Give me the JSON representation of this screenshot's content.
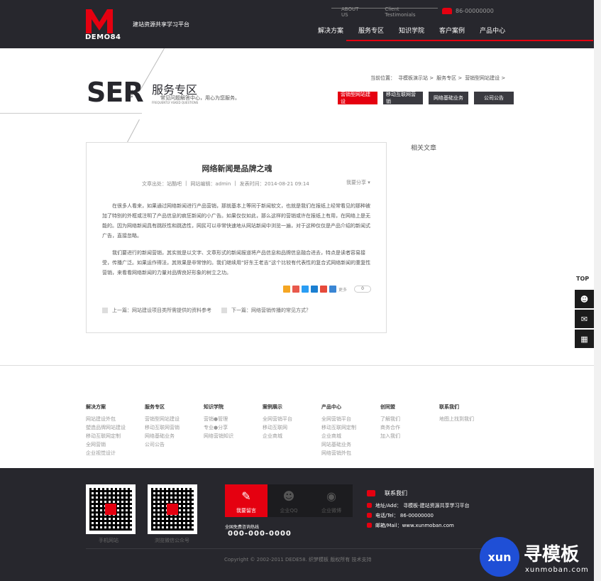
{
  "header": {
    "logo_text": "DEMO84",
    "tagline": "建站资源共享学习平台",
    "top_links": [
      "ABOUT US",
      "Client Testimonials"
    ],
    "phone": "86-00000000",
    "nav": [
      "解决方案",
      "服务专区",
      "知识学院",
      "客户案例",
      "产品中心"
    ]
  },
  "hero": {
    "logo": "SER",
    "logo_vert": "VICE",
    "title": "服务专区",
    "desc": "常见问题解答中心，用心为您服务。",
    "sub": "FREQUENTLY ASKED QUESTIONS",
    "breadcrumb": [
      "当前位置：",
      "寻模板演示站 >",
      "服务专区 >",
      "营销型网站建设 >"
    ],
    "tabs": [
      {
        "label": "营销型网站建设",
        "active": true
      },
      {
        "label": "移动互联网营销",
        "active": false
      },
      {
        "label": "网络基础业务",
        "active": false
      },
      {
        "label": "公司公告",
        "active": false
      }
    ]
  },
  "article": {
    "title": "网络新闻是品牌之魂",
    "meta": [
      "文章出处：站酷吧",
      "|",
      "网站编辑：admin",
      "|",
      "发表时间：2014-08-21 09:14"
    ],
    "share_label": "我要分享 ▾",
    "p1": "在很多人看来，如果通过网络新闻进行产品营销，那就基本上等同于新闻软文，也就是我们在报纸上经常看见的那种被加了特别的外框或注明了产品信息的疯狂新闻的小广告。如果仅仅如此，那么这样的营销或许在报纸上有用，在网络上是无能的。因为网络新闻具有跳跃性和跳选性，网民可以非常快速地从网站新闻中浏览一遍，对于这种仅仅是产品介绍的新闻式广告，直接忽略。",
    "p2": "我们要进行的新闻营销，其实就是以文字、文章形式的新闻报道将产品信息和品牌信息融合进去，特点是读者容易接受，传播广泛。如果运作得法，其效果是非常惊的。我们继续用“好东王老吉”这个比较有代表性的复合式网络新闻的重复性营销，来看看网络新闻的力量对品牌良好形象的树立之功。",
    "share_more": "更多",
    "share_count": "0",
    "prev": "上一篇：网站建设项目类所需提供的资料参考",
    "next": "下一篇：网络营销传播的常见方式？"
  },
  "sidebar": {
    "related": "相关文章",
    "top": "TOP"
  },
  "footer_links": [
    {
      "head": "解决方案",
      "items": [
        "网站建设外包",
        "塑造品牌网站建设",
        "移动互联网定制",
        "全网营销",
        "企业视觉设计"
      ]
    },
    {
      "head": "服务专区",
      "items": [
        "营销型网站建设",
        "移动互联网营销",
        "网络基础业务",
        "公司公告"
      ]
    },
    {
      "head": "知识学院",
      "items": [
        "营销●管理",
        "专业●分享",
        "网络营销知识"
      ]
    },
    {
      "head": "案例展示",
      "items": [
        "全网营销平台",
        "移动互联网",
        "企业商城"
      ]
    },
    {
      "head": "产品中心",
      "items": [
        "全网营销平台",
        "移动互联网定制",
        "企业商城",
        "网站基础业务",
        "网络营销外包"
      ]
    },
    {
      "head": "创同盟",
      "items": [
        "了解我们",
        "商务合作",
        "加入我们"
      ]
    },
    {
      "head": "联系我们",
      "items": [
        "地图上找到我们"
      ]
    }
  ],
  "footer": {
    "qr1_label": "手机网站",
    "qr2_label": "浏览微信公众号",
    "boxes": [
      {
        "label": "我要留言",
        "icon": "✎",
        "icon_name": "message-icon"
      },
      {
        "label": "企业QQ",
        "icon": "☻",
        "icon_name": "qq-icon"
      },
      {
        "label": "企业微博",
        "icon": "◉",
        "icon_name": "weibo-icon"
      }
    ],
    "hotline_label": "全国免费咨询热线",
    "hotline": "000-000-0000",
    "contact_title": "联系我们",
    "address": "地址/Add： 寻模板-建站资源共享学习平台",
    "tel": "电话/Tel： 86-00000000",
    "mail": "邮箱/Mail：www.xunmoban.com",
    "copyright": "Copyright © 2002-2011 DEDE58. 织梦模板 版权所有 技术支持"
  },
  "watermark": {
    "circle": "xun",
    "cn": "寻模板",
    "en": "xunmoban.com"
  },
  "colors": {
    "accent": "#e50010",
    "dark": "#27272d"
  }
}
